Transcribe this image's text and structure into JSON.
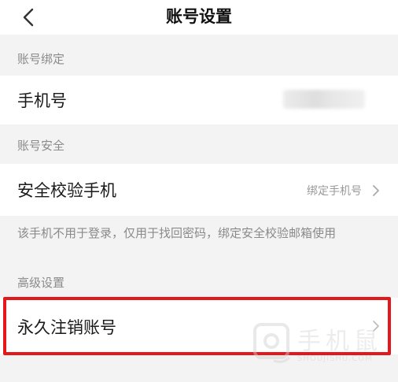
{
  "header": {
    "title": "账号设置"
  },
  "sections": [
    {
      "title": "账号绑定",
      "items": [
        {
          "label": "手机号",
          "value": ""
        }
      ]
    },
    {
      "title": "账号安全",
      "items": [
        {
          "label": "安全校验手机",
          "value": "绑定手机号"
        }
      ],
      "hint": "该手机不用于登录，仅用于找回密码，绑定安全校验邮箱使用"
    },
    {
      "title": "高级设置",
      "items": [
        {
          "label": "永久注销账号",
          "value": ""
        }
      ]
    }
  ],
  "watermark": {
    "text": "手机鼠",
    "sub": "SHOUJISHU.COM"
  },
  "colors": {
    "highlight": "#e4171b",
    "background": "#f3f3f3",
    "row": "#ffffff",
    "secondary_text": "#8a8a8a"
  },
  "icons": {
    "back": "chevron-left-icon",
    "row_arrow": "chevron-right-icon"
  }
}
